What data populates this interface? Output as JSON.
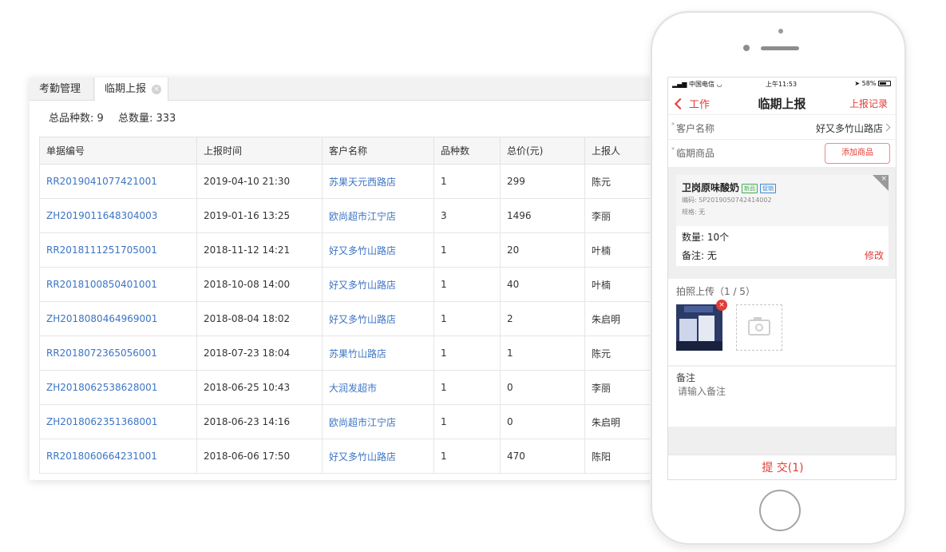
{
  "desktop": {
    "tabs": [
      {
        "label": "考勤管理"
      },
      {
        "label": "临期上报",
        "close": "×"
      }
    ],
    "summary": {
      "kinds": "总品种数: 9",
      "quantity": "总数量: 333"
    },
    "table": {
      "headers": [
        "单据编号",
        "上报时间",
        "客户名称",
        "品种数",
        "总价(元)",
        "上报人"
      ],
      "rows": [
        [
          "RR2019041077421001",
          "2019-04-10 21:30",
          "苏果天元西路店",
          "1",
          "299",
          "陈元"
        ],
        [
          "ZH2019011648304003",
          "2019-01-16 13:25",
          "欧尚超市江宁店",
          "3",
          "1496",
          "李丽"
        ],
        [
          "RR2018111251705001",
          "2018-11-12 14:21",
          "好又多竹山路店",
          "1",
          "20",
          "叶楠"
        ],
        [
          "RR2018100850401001",
          "2018-10-08 14:00",
          "好又多竹山路店",
          "1",
          "40",
          "叶楠"
        ],
        [
          "ZH2018080464969001",
          "2018-08-04 18:02",
          "好又多竹山路店",
          "1",
          "2",
          "朱启明"
        ],
        [
          "RR2018072365056001",
          "2018-07-23 18:04",
          "苏果竹山路店",
          "1",
          "1",
          "陈元"
        ],
        [
          "ZH2018062538628001",
          "2018-06-25 10:43",
          "大润发超市",
          "1",
          "0",
          "李丽"
        ],
        [
          "ZH2018062351368001",
          "2018-06-23 14:16",
          "欧尚超市江宁店",
          "1",
          "0",
          "朱启明"
        ],
        [
          "RR2018060664231001",
          "2018-06-06 17:50",
          "好又多竹山路店",
          "1",
          "470",
          "陈阳"
        ]
      ]
    }
  },
  "phone": {
    "status": {
      "carrier": "中国电信",
      "time": "上午11:53",
      "battery": "58%"
    },
    "nav": {
      "back": "工作",
      "title": "临期上报",
      "right": "上报记录"
    },
    "customer": {
      "required": "*",
      "label": "客户名称",
      "value": "好又多竹山路店"
    },
    "goods": {
      "required": "*",
      "label": "临期商品",
      "add_button": "添加商品"
    },
    "item": {
      "name": "卫岗原味酸奶",
      "tags": [
        "新品",
        "促销"
      ],
      "code": "编码: SP2019050742414002",
      "spec": "规格: 无",
      "qty": "数量:  10个",
      "note": "备注:  无",
      "edit": "修改",
      "remove": "×"
    },
    "photo": {
      "label": "拍照上传（1 / 5）",
      "delete": "×"
    },
    "note": {
      "label": "备注",
      "placeholder": "请输入备注"
    },
    "submit": "提  交(1)"
  },
  "colors": {
    "accent": "#e23c36",
    "link": "#3c74c4",
    "tag_new": "#3fae52",
    "tag_promo": "#3c8ad6"
  }
}
